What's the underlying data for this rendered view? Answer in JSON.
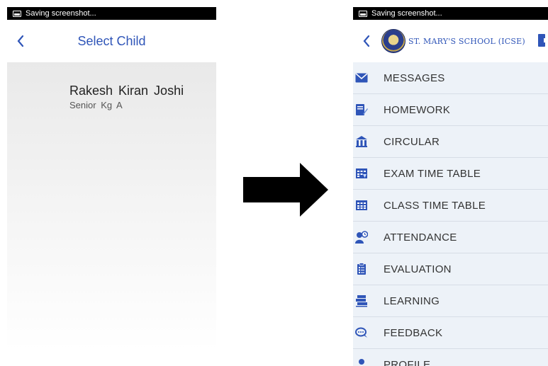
{
  "status_bar": {
    "text": "Saving screenshot..."
  },
  "left_screen": {
    "title": "Select Child",
    "child": {
      "name": "Rakesh  Kiran Joshi",
      "class_section": "Senior Kg  A"
    }
  },
  "right_screen": {
    "school_name": "ST. MARY'S SCHOOL (ICSE)",
    "menu": [
      {
        "label": "MESSAGES",
        "icon": "envelope-icon"
      },
      {
        "label": "HOMEWORK",
        "icon": "homework-notebook-icon"
      },
      {
        "label": "CIRCULAR",
        "icon": "circular-building-icon"
      },
      {
        "label": "EXAM TIME TABLE",
        "icon": "exam-timetable-icon"
      },
      {
        "label": "CLASS TIME TABLE",
        "icon": "class-timetable-icon"
      },
      {
        "label": "ATTENDANCE",
        "icon": "attendance-person-clock-icon"
      },
      {
        "label": "EVALUATION",
        "icon": "evaluation-clipboard-icon"
      },
      {
        "label": "LEARNING",
        "icon": "learning-books-icon"
      },
      {
        "label": "FEEDBACK",
        "icon": "feedback-chat-icon"
      },
      {
        "label": "PROFILE",
        "icon": "profile-person-icon"
      }
    ]
  },
  "colors": {
    "accent": "#2f55b8",
    "menu_bg": "#edf2f8",
    "status_bar": "#000000"
  }
}
